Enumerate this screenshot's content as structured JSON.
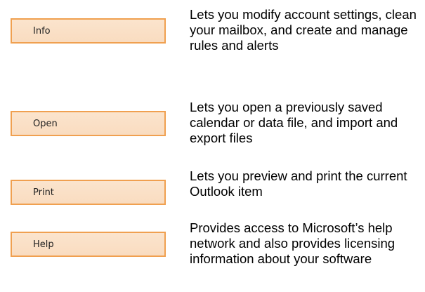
{
  "menu": {
    "items": [
      {
        "label": "Info",
        "description": "Lets you modify account settings, clean your mailbox, and create and manage rules and alerts"
      },
      {
        "label": "Open",
        "description": "Lets you open a previously saved calendar or data file, and import and export files"
      },
      {
        "label": "Print",
        "description": "Lets you preview and print the current Outlook item"
      },
      {
        "label": "Help",
        "description": "Provides access to Microsoft’s help network and also provides licensing information about your software"
      }
    ]
  },
  "colors": {
    "button_border": "#f0a050",
    "button_fill": "#fbe4cd"
  }
}
